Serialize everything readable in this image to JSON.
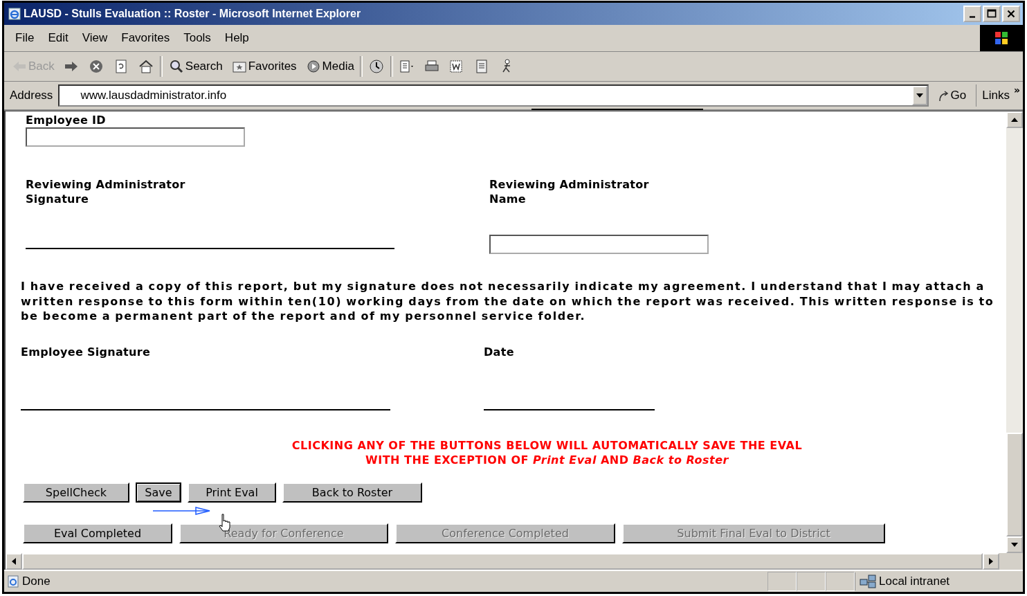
{
  "window": {
    "title": "LAUSD - Stulls Evaluation :: Roster - Microsoft Internet Explorer"
  },
  "menu": [
    "File",
    "Edit",
    "View",
    "Favorites",
    "Tools",
    "Help"
  ],
  "toolbar": [
    {
      "kind": "back",
      "label": "Back",
      "disabled": true
    },
    {
      "kind": "forward",
      "disabled": false
    },
    {
      "kind": "stop",
      "disabled": false
    },
    {
      "kind": "refresh",
      "disabled": false
    },
    {
      "kind": "home",
      "disabled": false
    },
    {
      "kind": "search",
      "label": "Search",
      "disabled": false
    },
    {
      "kind": "favorites",
      "label": "Favorites",
      "disabled": false
    },
    {
      "kind": "media",
      "label": "Media",
      "disabled": false
    },
    {
      "kind": "history",
      "disabled": false
    },
    {
      "kind": "mail",
      "disabled": false
    },
    {
      "kind": "print",
      "disabled": false
    },
    {
      "kind": "edit",
      "disabled": false
    },
    {
      "kind": "discuss",
      "disabled": false
    },
    {
      "kind": "messenger",
      "disabled": false
    }
  ],
  "address": {
    "label": "Address",
    "value": "www.lausdadministrator.info",
    "go": "Go",
    "links": "Links",
    "more": "»"
  },
  "form": {
    "employee_id_label": "Employee ID",
    "reviewer_signature_label": "Reviewing Administrator\nSignature",
    "reviewer_name_label": "Reviewing Administrator\nName",
    "statement": "I have received a copy of this report, but my signature does not necessarily indicate my agreement. I understand that I may attach a written response to this form within ten(10) working days from the date on which the report was received. This written response is to be become a permanent part of the report and of my personnel service folder.",
    "employee_signature_label": "Employee Signature",
    "date_label": "Date",
    "notice": [
      "CLICKING ANY OF THE BUTTONS BELOW WILL AUTOMATICALLY SAVE THE EVAL",
      "WITH THE EXCEPTION OF *Print Eval* AND *Back to Roster*"
    ]
  },
  "button_rows": [
    [
      {
        "label": "SpellCheck",
        "disabled": false,
        "focused": false
      },
      {
        "label": "Save",
        "disabled": false,
        "focused": true
      },
      {
        "label": "Print Eval",
        "disabled": false,
        "focused": false
      },
      {
        "label": "Back to Roster",
        "disabled": false,
        "focused": false
      }
    ],
    [
      {
        "label": "Eval Completed",
        "disabled": false,
        "focused": false
      },
      {
        "label": "Ready for Conference",
        "disabled": true,
        "focused": false
      },
      {
        "label": "Conference Completed",
        "disabled": true,
        "focused": false
      },
      {
        "label": "Submit Final Eval to District",
        "disabled": true,
        "focused": false
      }
    ]
  ],
  "status_bar": {
    "text": "Done",
    "zone": "Local intranet"
  }
}
